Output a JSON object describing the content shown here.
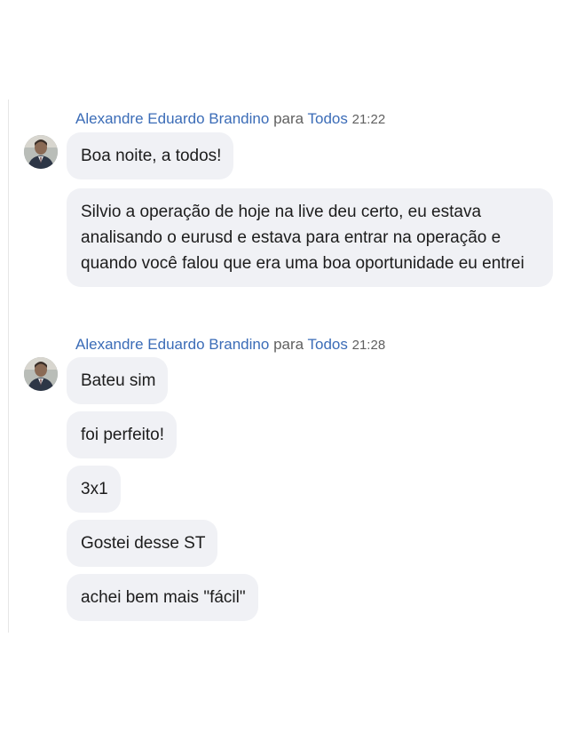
{
  "messages": [
    {
      "sender": "Alexandre Eduardo Brandino",
      "to_word": "para",
      "recipient": "Todos",
      "time": "21:22",
      "bubbles": [
        "Boa noite, a todos!",
        "Silvio a operação de hoje na live deu certo, eu estava analisando o eurusd e estava para entrar na operação e quando você falou que era uma boa oportunidade eu entrei"
      ]
    },
    {
      "sender": "Alexandre Eduardo Brandino",
      "to_word": "para",
      "recipient": "Todos",
      "time": "21:28",
      "bubbles": [
        "Bateu sim",
        "foi perfeito!",
        "3x1",
        "Gostei desse ST",
        "achei bem mais \"fácil\""
      ]
    }
  ]
}
